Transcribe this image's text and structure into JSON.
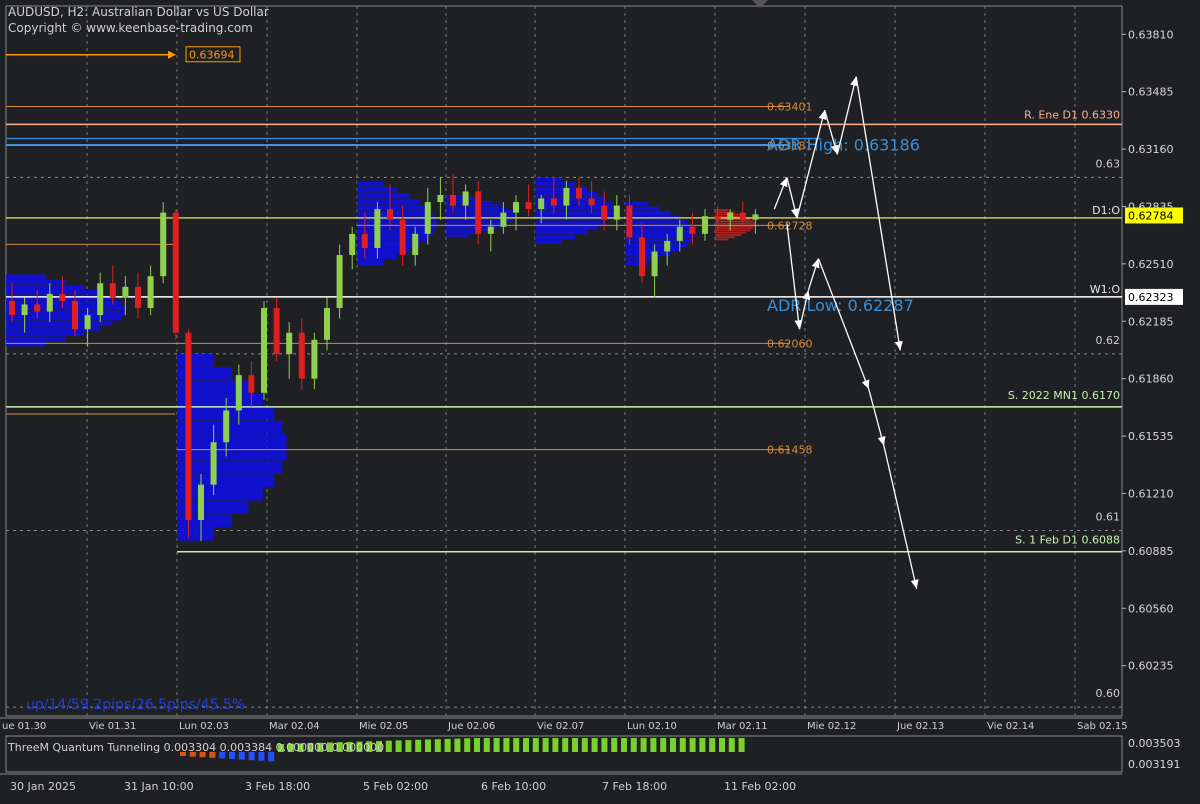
{
  "header": {
    "symbol_line": "AUDUSD, H2:  Australian Dollar vs US Dollar",
    "copyright": "Copyright © www.keenbase-trading.com"
  },
  "chart_data": {
    "type": "candlestick",
    "ylim": [
      0.5995,
      0.6397
    ],
    "price_ticks": [
      "0.63810",
      "0.63485",
      "0.63160",
      "0.62835",
      "0.62510",
      "0.62185",
      "0.61860",
      "0.61535",
      "0.61210",
      "0.60885",
      "0.60560",
      "0.60235"
    ],
    "round_levels": [
      {
        "label": "0.63",
        "value": 0.63
      },
      {
        "label": "0.62",
        "value": 0.62
      },
      {
        "label": "0.61",
        "value": 0.61
      },
      {
        "label": "0.60",
        "value": 0.6
      }
    ],
    "time_ticks": [
      "ue 01.30",
      "Vie 01.31",
      "Lun 02.03",
      "Mar 02.04",
      "Mie 02.05",
      "Jue 02.06",
      "Vie 02.07",
      "Lun 02.10",
      "Mar 02.11",
      "Mie 02.12",
      "Jue 02.13",
      "Vie 02.14",
      "Sab 02.15"
    ],
    "bottom_dates": [
      "30 Jan 2025",
      "31 Jan 10:00",
      "3 Feb 18:00",
      "5 Feb 02:00",
      "6 Feb 10:00",
      "7 Feb 18:00",
      "11 Feb 02:00"
    ],
    "current_price": {
      "label": "0.62784",
      "value": 0.62784,
      "color": "#ffff00"
    },
    "price_box_w1": {
      "label": "0.62323",
      "value": 0.62323
    },
    "target_label": {
      "text": "0.63694",
      "value": 0.63694,
      "color": "#ff9900"
    },
    "levels": [
      {
        "label": "0.63401",
        "value": 0.63401,
        "color": "#d88a3c"
      },
      {
        "label": "0.62728",
        "value": 0.62728,
        "color": "#d88a3c"
      },
      {
        "label": "0.62060",
        "value": 0.6206,
        "color": "#d88a3c"
      },
      {
        "label": "0.61458",
        "value": 0.61458,
        "color": "#d88a3c"
      },
      {
        "label": "0.63181",
        "value": 0.63181,
        "color": "#d88a3c"
      }
    ],
    "resistance": {
      "label": "R. Ene D1 0.6330",
      "value": 0.633,
      "color": "#ffb08a"
    },
    "supports": [
      {
        "label": "S. 2022 MN1 0.6170",
        "value": 0.617,
        "color": "#c8f0b0"
      },
      {
        "label": "S. 1 Feb D1 0.6088",
        "value": 0.6088,
        "color": "#c8f0b0"
      }
    ],
    "open_lines": [
      {
        "label": "D1:O",
        "value": 0.6277
      },
      {
        "label": "W1:O",
        "value": 0.62323
      }
    ],
    "adr": {
      "high_label": "ADR High: 0.63186",
      "high_value": 0.63186,
      "low_label": "ADR Low: 0.62287",
      "low_value": 0.62287,
      "color": "#3a8ed8"
    },
    "stats_text": "up/14/59.2pips/26.5pips/45.5%",
    "candles": [
      {
        "o": 0.623,
        "h": 0.624,
        "l": 0.6218,
        "c": 0.6222
      },
      {
        "o": 0.6222,
        "h": 0.6232,
        "l": 0.6212,
        "c": 0.6228
      },
      {
        "o": 0.6228,
        "h": 0.6236,
        "l": 0.622,
        "c": 0.6224
      },
      {
        "o": 0.6224,
        "h": 0.624,
        "l": 0.6218,
        "c": 0.6234
      },
      {
        "o": 0.6234,
        "h": 0.6244,
        "l": 0.6226,
        "c": 0.623
      },
      {
        "o": 0.623,
        "h": 0.6236,
        "l": 0.621,
        "c": 0.6214
      },
      {
        "o": 0.6214,
        "h": 0.6226,
        "l": 0.6204,
        "c": 0.6222
      },
      {
        "o": 0.6222,
        "h": 0.6246,
        "l": 0.6218,
        "c": 0.624
      },
      {
        "o": 0.624,
        "h": 0.625,
        "l": 0.6228,
        "c": 0.6232
      },
      {
        "o": 0.6232,
        "h": 0.6244,
        "l": 0.6222,
        "c": 0.6238
      },
      {
        "o": 0.6238,
        "h": 0.6246,
        "l": 0.622,
        "c": 0.6226
      },
      {
        "o": 0.6226,
        "h": 0.625,
        "l": 0.6222,
        "c": 0.6244
      },
      {
        "o": 0.6244,
        "h": 0.6286,
        "l": 0.624,
        "c": 0.628
      },
      {
        "o": 0.628,
        "h": 0.6282,
        "l": 0.6208,
        "c": 0.6212
      },
      {
        "o": 0.6212,
        "h": 0.6214,
        "l": 0.6096,
        "c": 0.6106
      },
      {
        "o": 0.6106,
        "h": 0.6132,
        "l": 0.6094,
        "c": 0.6126
      },
      {
        "o": 0.6126,
        "h": 0.616,
        "l": 0.612,
        "c": 0.615
      },
      {
        "o": 0.615,
        "h": 0.6175,
        "l": 0.6142,
        "c": 0.6168
      },
      {
        "o": 0.6168,
        "h": 0.6194,
        "l": 0.616,
        "c": 0.6188
      },
      {
        "o": 0.6188,
        "h": 0.6196,
        "l": 0.617,
        "c": 0.6178
      },
      {
        "o": 0.6178,
        "h": 0.623,
        "l": 0.6174,
        "c": 0.6226
      },
      {
        "o": 0.6226,
        "h": 0.6232,
        "l": 0.6196,
        "c": 0.62
      },
      {
        "o": 0.62,
        "h": 0.6218,
        "l": 0.6186,
        "c": 0.6212
      },
      {
        "o": 0.6212,
        "h": 0.622,
        "l": 0.618,
        "c": 0.6186
      },
      {
        "o": 0.6186,
        "h": 0.6212,
        "l": 0.618,
        "c": 0.6208
      },
      {
        "o": 0.6208,
        "h": 0.6232,
        "l": 0.6202,
        "c": 0.6226
      },
      {
        "o": 0.6226,
        "h": 0.6262,
        "l": 0.622,
        "c": 0.6256
      },
      {
        "o": 0.6256,
        "h": 0.6272,
        "l": 0.6248,
        "c": 0.6268
      },
      {
        "o": 0.6268,
        "h": 0.628,
        "l": 0.6254,
        "c": 0.626
      },
      {
        "o": 0.626,
        "h": 0.6286,
        "l": 0.6254,
        "c": 0.6282
      },
      {
        "o": 0.6282,
        "h": 0.6296,
        "l": 0.627,
        "c": 0.6276
      },
      {
        "o": 0.6276,
        "h": 0.6284,
        "l": 0.625,
        "c": 0.6256
      },
      {
        "o": 0.6256,
        "h": 0.6272,
        "l": 0.625,
        "c": 0.6268
      },
      {
        "o": 0.6268,
        "h": 0.6294,
        "l": 0.6262,
        "c": 0.6286
      },
      {
        "o": 0.6286,
        "h": 0.63,
        "l": 0.6276,
        "c": 0.629
      },
      {
        "o": 0.629,
        "h": 0.6302,
        "l": 0.628,
        "c": 0.6284
      },
      {
        "o": 0.6284,
        "h": 0.6296,
        "l": 0.6276,
        "c": 0.6292
      },
      {
        "o": 0.6292,
        "h": 0.6298,
        "l": 0.6262,
        "c": 0.6268
      },
      {
        "o": 0.6268,
        "h": 0.6276,
        "l": 0.6258,
        "c": 0.6272
      },
      {
        "o": 0.6272,
        "h": 0.6286,
        "l": 0.6268,
        "c": 0.628
      },
      {
        "o": 0.628,
        "h": 0.629,
        "l": 0.627,
        "c": 0.6286
      },
      {
        "o": 0.6286,
        "h": 0.6296,
        "l": 0.6278,
        "c": 0.6282
      },
      {
        "o": 0.6282,
        "h": 0.629,
        "l": 0.6274,
        "c": 0.6288
      },
      {
        "o": 0.6288,
        "h": 0.63,
        "l": 0.628,
        "c": 0.6284
      },
      {
        "o": 0.6284,
        "h": 0.6298,
        "l": 0.6276,
        "c": 0.6294
      },
      {
        "o": 0.6294,
        "h": 0.63,
        "l": 0.6284,
        "c": 0.6288
      },
      {
        "o": 0.6288,
        "h": 0.6298,
        "l": 0.628,
        "c": 0.6284
      },
      {
        "o": 0.6284,
        "h": 0.6292,
        "l": 0.627,
        "c": 0.6276
      },
      {
        "o": 0.6276,
        "h": 0.629,
        "l": 0.627,
        "c": 0.6284
      },
      {
        "o": 0.6284,
        "h": 0.629,
        "l": 0.6262,
        "c": 0.6266
      },
      {
        "o": 0.6266,
        "h": 0.6274,
        "l": 0.624,
        "c": 0.6244
      },
      {
        "o": 0.6244,
        "h": 0.6262,
        "l": 0.6232,
        "c": 0.6258
      },
      {
        "o": 0.6258,
        "h": 0.6268,
        "l": 0.625,
        "c": 0.6264
      },
      {
        "o": 0.6264,
        "h": 0.6276,
        "l": 0.6258,
        "c": 0.6272
      },
      {
        "o": 0.6272,
        "h": 0.628,
        "l": 0.6262,
        "c": 0.6268
      },
      {
        "o": 0.6268,
        "h": 0.6282,
        "l": 0.6264,
        "c": 0.6278
      },
      {
        "o": 0.6278,
        "h": 0.6284,
        "l": 0.627,
        "c": 0.6276
      },
      {
        "o": 0.6276,
        "h": 0.6282,
        "l": 0.627,
        "c": 0.628
      },
      {
        "o": 0.628,
        "h": 0.6286,
        "l": 0.6272,
        "c": 0.6276
      },
      {
        "o": 0.6276,
        "h": 0.6282,
        "l": 0.6268,
        "c": 0.6279
      }
    ],
    "forecast_path_1": [
      {
        "t": 60.5,
        "p": 0.6282
      },
      {
        "t": 61.5,
        "p": 0.63
      },
      {
        "t": 62.3,
        "p": 0.6277
      },
      {
        "t": 64.5,
        "p": 0.6338
      },
      {
        "t": 65.5,
        "p": 0.6313
      },
      {
        "t": 67.0,
        "p": 0.6357
      },
      {
        "t": 70.5,
        "p": 0.6202
      }
    ],
    "forecast_path_2": [
      {
        "t": 61.5,
        "p": 0.6274
      },
      {
        "t": 62.5,
        "p": 0.6214
      },
      {
        "t": 63.2,
        "p": 0.6236
      },
      {
        "t": 64.0,
        "p": 0.6254
      },
      {
        "t": 68.0,
        "p": 0.618
      },
      {
        "t": 69.2,
        "p": 0.6148
      },
      {
        "t": 71.8,
        "p": 0.6067
      }
    ],
    "indicator": {
      "label": "ThreeM Quantum Tunneling 0.003304 0.003384 0.000000 0.000000",
      "ticks": [
        "0.003503",
        "0.003191"
      ]
    }
  }
}
